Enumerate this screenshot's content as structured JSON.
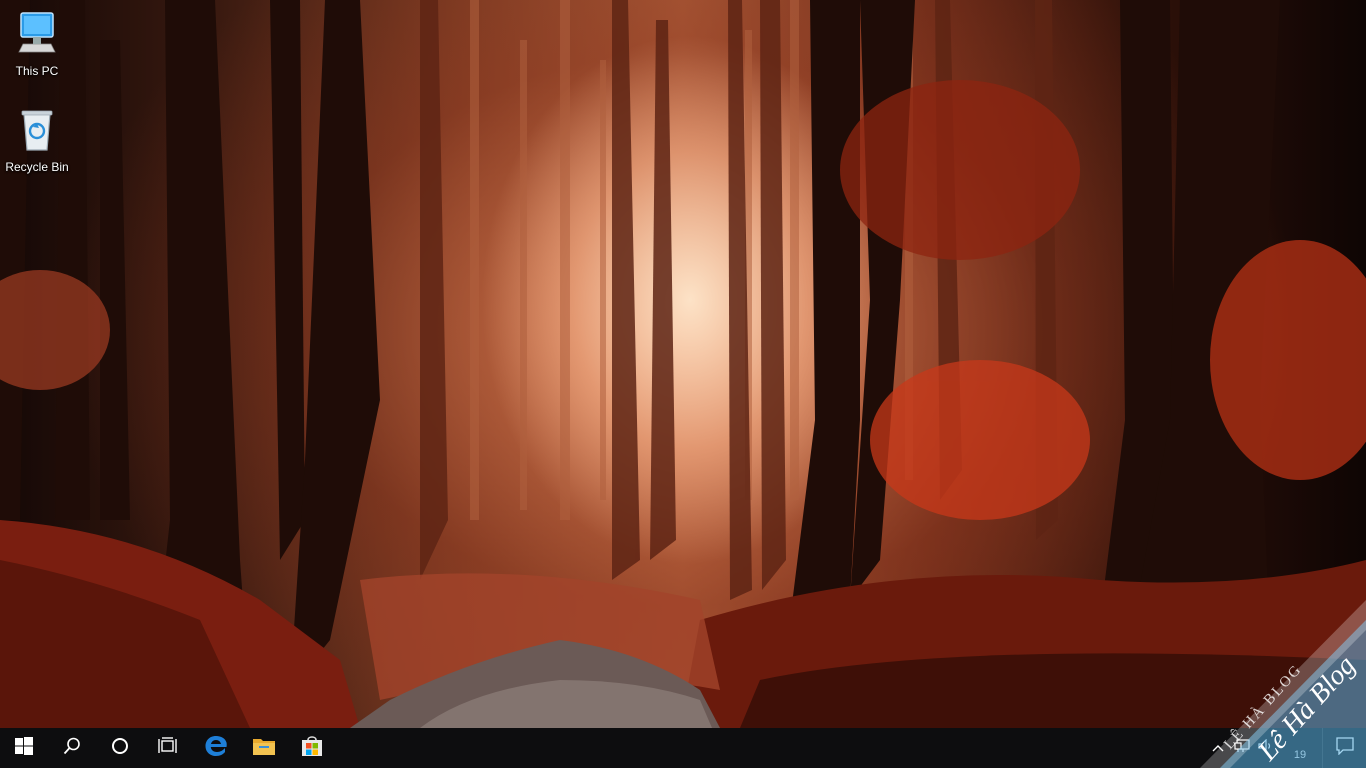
{
  "desktop": {
    "icons": [
      {
        "label": "This PC",
        "icon": "this-pc-icon"
      },
      {
        "label": "Recycle Bin",
        "icon": "recycle-bin-icon"
      }
    ]
  },
  "taskbar": {
    "start": "windows-logo-icon",
    "search": "search-icon",
    "cortana": "cortana-circle-icon",
    "task_view": "task-view-icon",
    "pinned": [
      {
        "name": "Microsoft Edge",
        "icon": "edge-icon"
      },
      {
        "name": "File Explorer",
        "icon": "file-explorer-icon"
      },
      {
        "name": "Microsoft Store",
        "icon": "store-icon"
      }
    ],
    "tray": {
      "clock_partial": "19"
    }
  },
  "watermark": {
    "primary": "Lê Hà Blog",
    "secondary": "LÊ HÀ BLOG"
  },
  "colors": {
    "taskbar": "#0d0d0f",
    "edge_blue": "#1e7fd8",
    "folder_yellow": "#f2c250",
    "watermark": "#5ab4e6"
  }
}
